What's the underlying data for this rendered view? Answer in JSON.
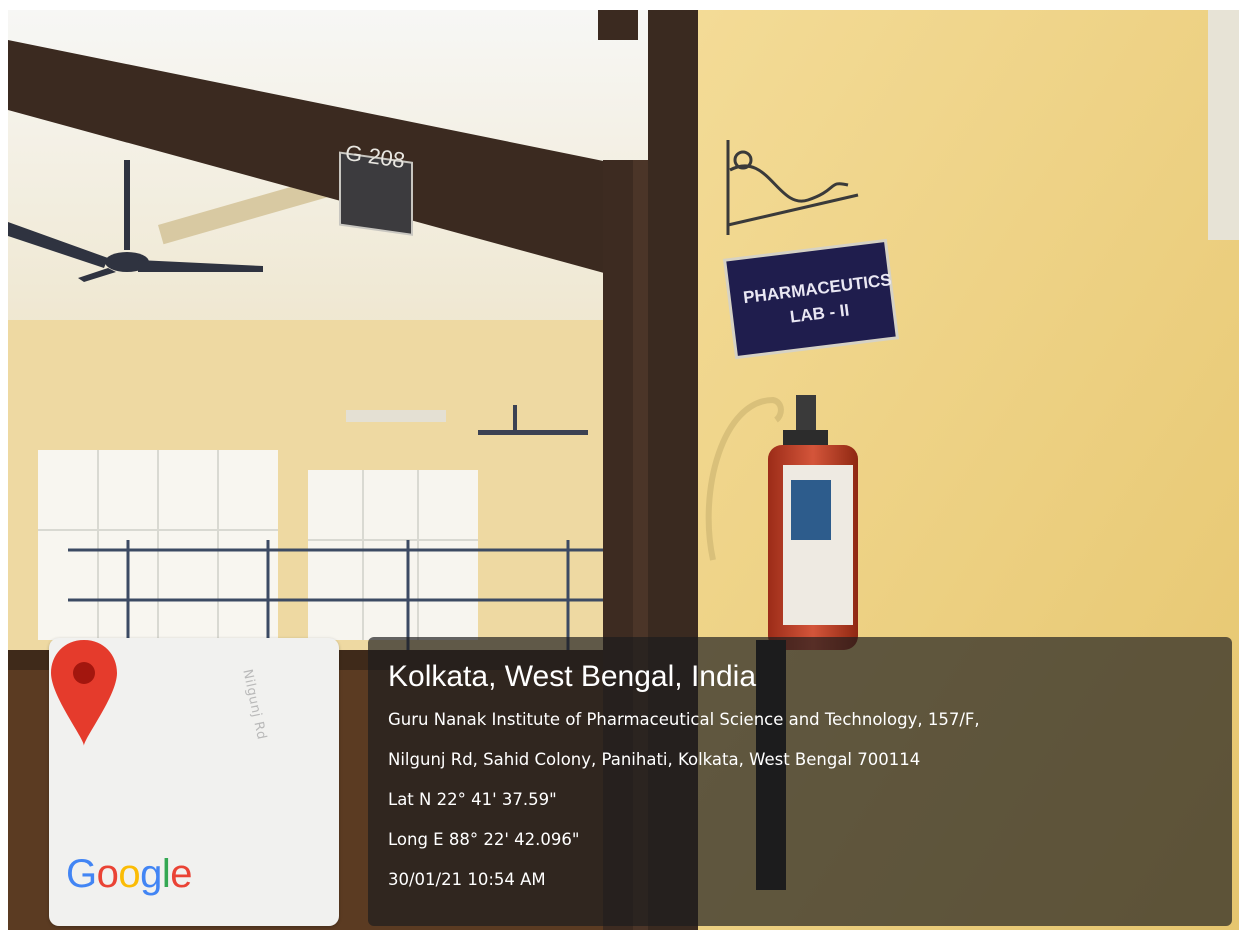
{
  "scene": {
    "room_sign": "G 208",
    "door_sign_lines": [
      "PHARMACEUTICS",
      "LAB - II"
    ],
    "colors": {
      "wall": "#efd589",
      "beam": "#3a2a20",
      "sign": "#1f1d4d",
      "extinguisher": "#c7432a"
    }
  },
  "map_card": {
    "road_label": "Nilgunj Rd",
    "pin_icon": "map-pin-icon",
    "logo": [
      "G",
      "o",
      "o",
      "g",
      "l",
      "e"
    ],
    "logo_colors": [
      "#4285f4",
      "#ea4335",
      "#fbbc05",
      "#4285f4",
      "#34a853",
      "#ea4335"
    ]
  },
  "location": {
    "title": "Kolkata, West Bengal, India",
    "address_line1": "Guru Nanak Institute of Pharmaceutical Science and Technology, 157/F,",
    "address_line2": "Nilgunj Rd, Sahid Colony, Panihati, Kolkata, West Bengal 700114",
    "latitude": "Lat N 22° 41' 37.59\"",
    "longitude": "Long E 88° 22' 42.096\"",
    "timestamp": "30/01/21 10:54 AM"
  }
}
